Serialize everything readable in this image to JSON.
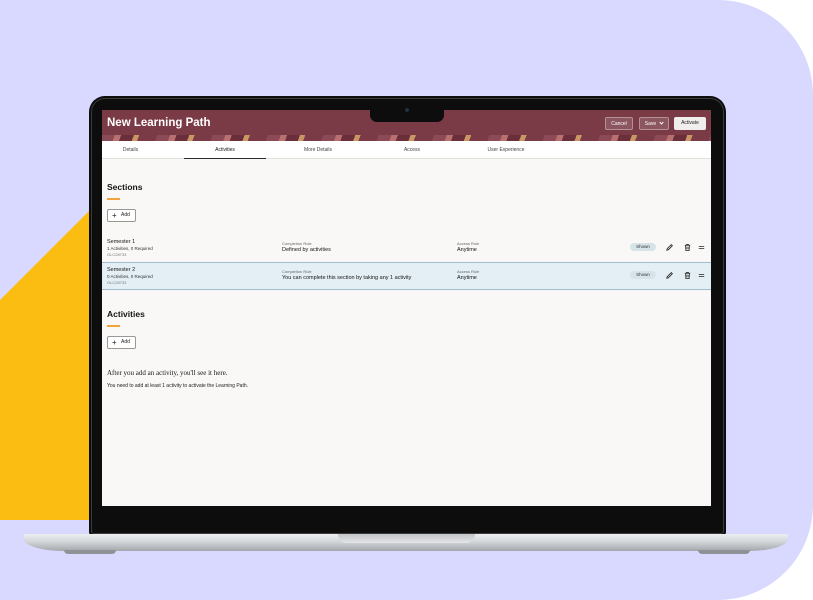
{
  "app": {
    "title": "New Learning Path"
  },
  "header": {
    "cancel_label": "Cancel",
    "save_label": "Save",
    "activate_label": "Activate"
  },
  "tabs": [
    {
      "label": "Details"
    },
    {
      "label": "Activities",
      "active": true
    },
    {
      "label": "More Details"
    },
    {
      "label": "Access"
    },
    {
      "label": "User Experience"
    }
  ],
  "sections": {
    "heading": "Sections",
    "add_label": "Add",
    "rows": [
      {
        "name": "Semester 1",
        "counts": "1 Activities, 0 Required",
        "code": "OLC28733",
        "completion_label": "Completion Rule",
        "completion_value": "Defined by activities",
        "access_label": "Access Rule",
        "access_value": "Anytime",
        "status": "Shown",
        "selected": false
      },
      {
        "name": "Semester 2",
        "counts": "0 Activities, 0 Required",
        "code": "OLC28733",
        "completion_label": "Completion Rule",
        "completion_value": "You can complete this section by taking any  1 activity",
        "access_label": "Access Rule",
        "access_value": "Anytime",
        "status": "Shown",
        "selected": true
      }
    ]
  },
  "activities": {
    "heading": "Activities",
    "add_label": "Add",
    "empty_title": "After you add an activity, you'll see it here.",
    "empty_text": "You need to add at least 1 activity to activate the Learning Path."
  },
  "icons": [
    "plus-icon",
    "pencil-icon",
    "trash-icon",
    "drag-handle-icon",
    "chevron-down-icon",
    "camera-icon"
  ],
  "colors": {
    "header": "#7a3b47",
    "accent": "#f0a43c",
    "selected_row": "#e3eff5",
    "backdrop": "#d9d8ff",
    "shape": "#fbbd11"
  }
}
